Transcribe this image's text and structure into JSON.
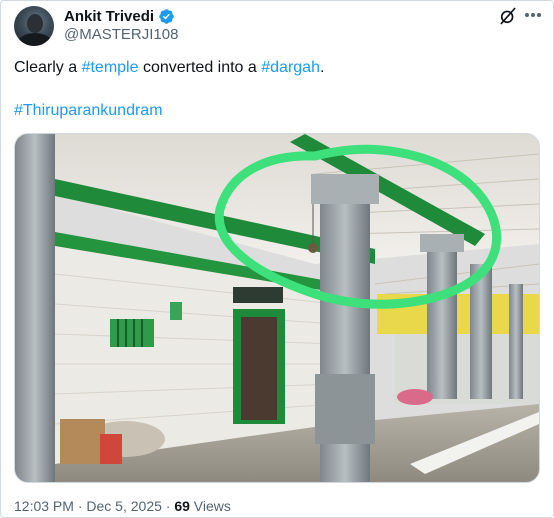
{
  "author": {
    "display_name": "Ankit Trivedi",
    "handle": "@MASTERJI108",
    "verified": true,
    "avatar_icon": "avatar-photo"
  },
  "post": {
    "text_prefix": "Clearly a ",
    "hashtag_1": "#temple",
    "text_middle": " converted into a ",
    "hashtag_2": "#dargah",
    "text_suffix": ".",
    "hashtag_3": "#Thiruparankundram"
  },
  "meta": {
    "time": "12:03 PM",
    "separator": " · ",
    "date": "Dec 5, 2025",
    "views_count": "69",
    "views_label": " Views"
  },
  "icons": {
    "grok": "grok-slash-icon",
    "more": "more-icon"
  },
  "colors": {
    "link": "#1d9bf0",
    "verified": "#1d9bf0",
    "secondary_text": "#536471",
    "highlight_marker": "#3de07a"
  }
}
